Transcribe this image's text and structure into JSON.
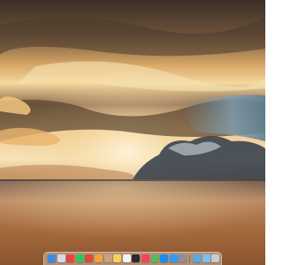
{
  "wallpaper": {
    "sky_top": "#3b2f27",
    "sky_glow": "#f3c988",
    "sky_blue": "#7fa2b6",
    "sea": "#a1663a"
  },
  "dock": {
    "apps": [
      {
        "icon": "finder-icon",
        "color": "#3d8be0"
      },
      {
        "icon": "launchpad-icon",
        "color": "#d6d9df"
      },
      {
        "icon": "chrome-icon",
        "color": "#e8453c"
      },
      {
        "icon": "messages-icon",
        "color": "#36c35a"
      },
      {
        "icon": "search-app-icon",
        "color": "#d94a3a"
      },
      {
        "icon": "photos-icon",
        "color": "#f2a33a"
      },
      {
        "icon": "contacts-icon",
        "color": "#c8a27a"
      },
      {
        "icon": "notes-icon",
        "color": "#f3d35a"
      },
      {
        "icon": "calendar-icon",
        "color": "#f4f4f4"
      },
      {
        "icon": "terminal-icon",
        "color": "#2b2b2b"
      },
      {
        "icon": "music-icon",
        "color": "#f2465a"
      },
      {
        "icon": "maps-icon",
        "color": "#5cb85c"
      },
      {
        "icon": "app-store-icon",
        "color": "#1b8df0"
      },
      {
        "icon": "safari-icon",
        "color": "#2f9cf5"
      },
      {
        "icon": "settings-icon",
        "color": "#8e8e93"
      }
    ],
    "stack": [
      {
        "icon": "downloads-folder-icon",
        "color": "#5aa9e6"
      },
      {
        "icon": "documents-folder-icon",
        "color": "#7cc0f0"
      },
      {
        "icon": "trash-icon",
        "color": "#c9ccd1"
      }
    ]
  }
}
